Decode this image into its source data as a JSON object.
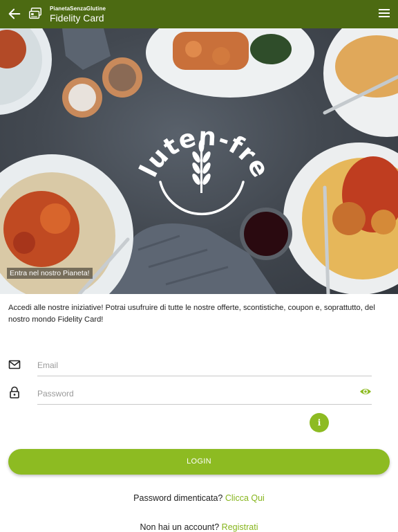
{
  "header": {
    "app_name": "PianetaSenzaGlutine",
    "title": "Fidelity Card",
    "back_icon": "arrow-left-icon",
    "card_icon": "card-icon",
    "menu_icon": "hamburger-menu-icon",
    "bar_color": "#4c6a12"
  },
  "hero": {
    "logo_text": "gluten-free",
    "caption": "Entra nel nostro Pianeta!"
  },
  "intro": {
    "text": "Accedi alle nostre iniziative! Potrai usufruire di tutte le nostre offerte, scontistiche, coupon e, soprattutto, del nostro mondo Fidelity Card!"
  },
  "form": {
    "email_placeholder": "Email",
    "email_value": "",
    "email_icon": "envelope-icon",
    "password_placeholder": "Password",
    "password_value": "",
    "password_icon": "padlock-icon",
    "show_password_icon": "eye-icon",
    "info_label": "i",
    "login_label": "LOGIN"
  },
  "links": {
    "forgot_text": "Password dimenticata?",
    "forgot_link": "Clicca Qui",
    "register_text": "Non hai un account?",
    "register_link": "Registrati"
  },
  "colors": {
    "accent": "#8dbb22",
    "header": "#4c6a12"
  }
}
